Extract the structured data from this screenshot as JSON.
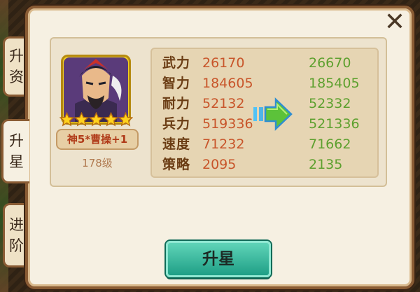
{
  "tabs": [
    {
      "label": [
        "升",
        "资"
      ]
    },
    {
      "label": [
        "升",
        "星"
      ]
    },
    {
      "label": [
        "进",
        "阶"
      ]
    }
  ],
  "icons": {
    "close": "close-icon",
    "arrow": "right-arrow-icon",
    "star": "star-icon"
  },
  "hero": {
    "name": "神5*曹操+1",
    "level": "178级",
    "stars": 5
  },
  "stats": [
    {
      "label": "武力",
      "old": "26170",
      "new": "26670"
    },
    {
      "label": "智力",
      "old": "184605",
      "new": "185405"
    },
    {
      "label": "耐力",
      "old": "52132",
      "new": "52332"
    },
    {
      "label": "兵力",
      "old": "519336",
      "new": "521336"
    },
    {
      "label": "速度",
      "old": "71232",
      "new": "71662"
    },
    {
      "label": "策略",
      "old": "2095",
      "new": "2135"
    }
  ],
  "upgrade_button": "升星",
  "colors": {
    "old_value": "#c8552a",
    "new_value": "#5da02e",
    "button": "#2fb396"
  }
}
